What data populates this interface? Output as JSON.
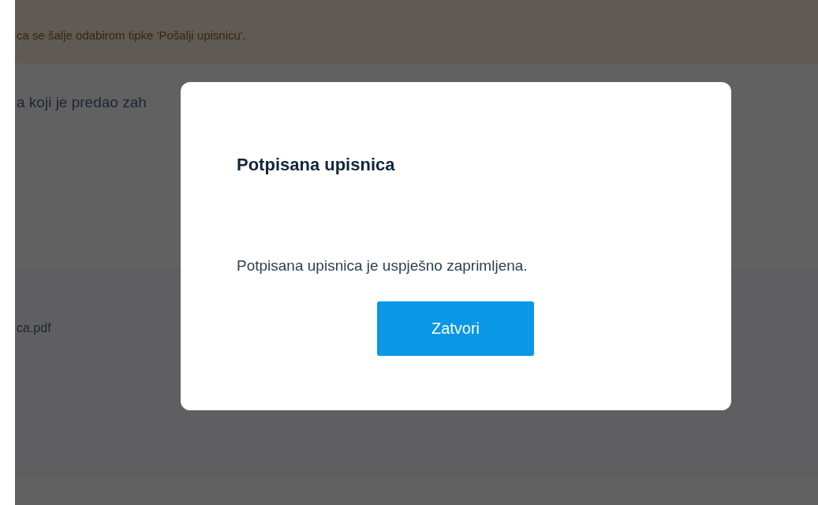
{
  "banner": {
    "text": "ca se šalje odabirom tipke 'Pošalji upisnicu'."
  },
  "page": {
    "heading": "a koji je predao zah",
    "file_name": "ca.pdf"
  },
  "dialog": {
    "title": "Potpisana upisnica",
    "message": "Potpisana upisnica je uspješno zaprimljena.",
    "button": "Zatvori"
  }
}
